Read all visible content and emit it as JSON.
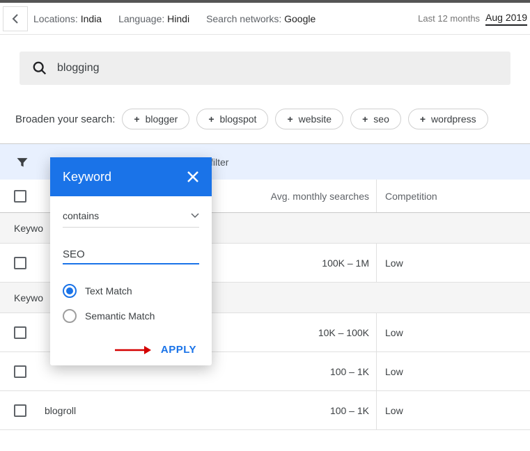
{
  "breadcrumb": {
    "locations_label": "Locations:",
    "locations_value": "India",
    "language_label": "Language:",
    "language_value": "Hindi",
    "networks_label": "Search networks:",
    "networks_value": "Google",
    "date_label": "Last 12 months",
    "date_range": "Aug 2019"
  },
  "search": {
    "value": "blogging"
  },
  "broaden": {
    "label": "Broaden your search:",
    "chips": [
      "blogger",
      "blogspot",
      "website",
      "seo",
      "wordpress"
    ]
  },
  "filter": {
    "add_text": "filter",
    "popover": {
      "title": "Keyword",
      "dropdown": "contains",
      "input_value": "SEO",
      "radio_text": "Text Match",
      "radio_semantic": "Semantic Match",
      "apply": "APPLY"
    }
  },
  "table": {
    "col_search": "Avg. monthly searches",
    "col_comp": "Competition",
    "section1": "Keywo",
    "section2": "Keywo",
    "rows": [
      {
        "kw": "",
        "search": "100K – 1M",
        "comp": "Low"
      },
      {
        "kw": "",
        "search": "10K – 100K",
        "comp": "Low"
      },
      {
        "kw": "",
        "search": "100 – 1K",
        "comp": "Low"
      },
      {
        "kw": "blogroll",
        "search": "100 – 1K",
        "comp": "Low"
      }
    ]
  }
}
